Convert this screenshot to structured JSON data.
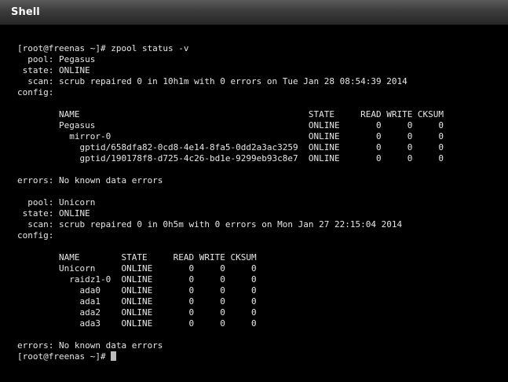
{
  "window": {
    "title": "Shell"
  },
  "terminal": {
    "lines": [
      "[root@freenas ~]# zpool status -v",
      "  pool: Pegasus",
      " state: ONLINE",
      "  scan: scrub repaired 0 in 10h1m with 0 errors on Tue Jan 28 08:54:39 2014",
      "config:",
      "",
      "        NAME                                            STATE     READ WRITE CKSUM",
      "        Pegasus                                         ONLINE       0     0     0",
      "          mirror-0                                      ONLINE       0     0     0",
      "            gptid/658dfa82-0cd8-4e14-8fa5-0dd2a3ac3259  ONLINE       0     0     0",
      "            gptid/190178f8-d725-4c26-bd1e-9299eb93c8e7  ONLINE       0     0     0",
      "",
      "errors: No known data errors",
      "",
      "  pool: Unicorn",
      " state: ONLINE",
      "  scan: scrub repaired 0 in 0h5m with 0 errors on Mon Jan 27 22:15:04 2014",
      "config:",
      "",
      "        NAME        STATE     READ WRITE CKSUM",
      "        Unicorn     ONLINE       0     0     0",
      "          raidz1-0  ONLINE       0     0     0",
      "            ada0    ONLINE       0     0     0",
      "            ada1    ONLINE       0     0     0",
      "            ada2    ONLINE       0     0     0",
      "            ada3    ONLINE       0     0     0",
      "",
      "errors: No known data errors"
    ],
    "prompt": "[root@freenas ~]# "
  }
}
